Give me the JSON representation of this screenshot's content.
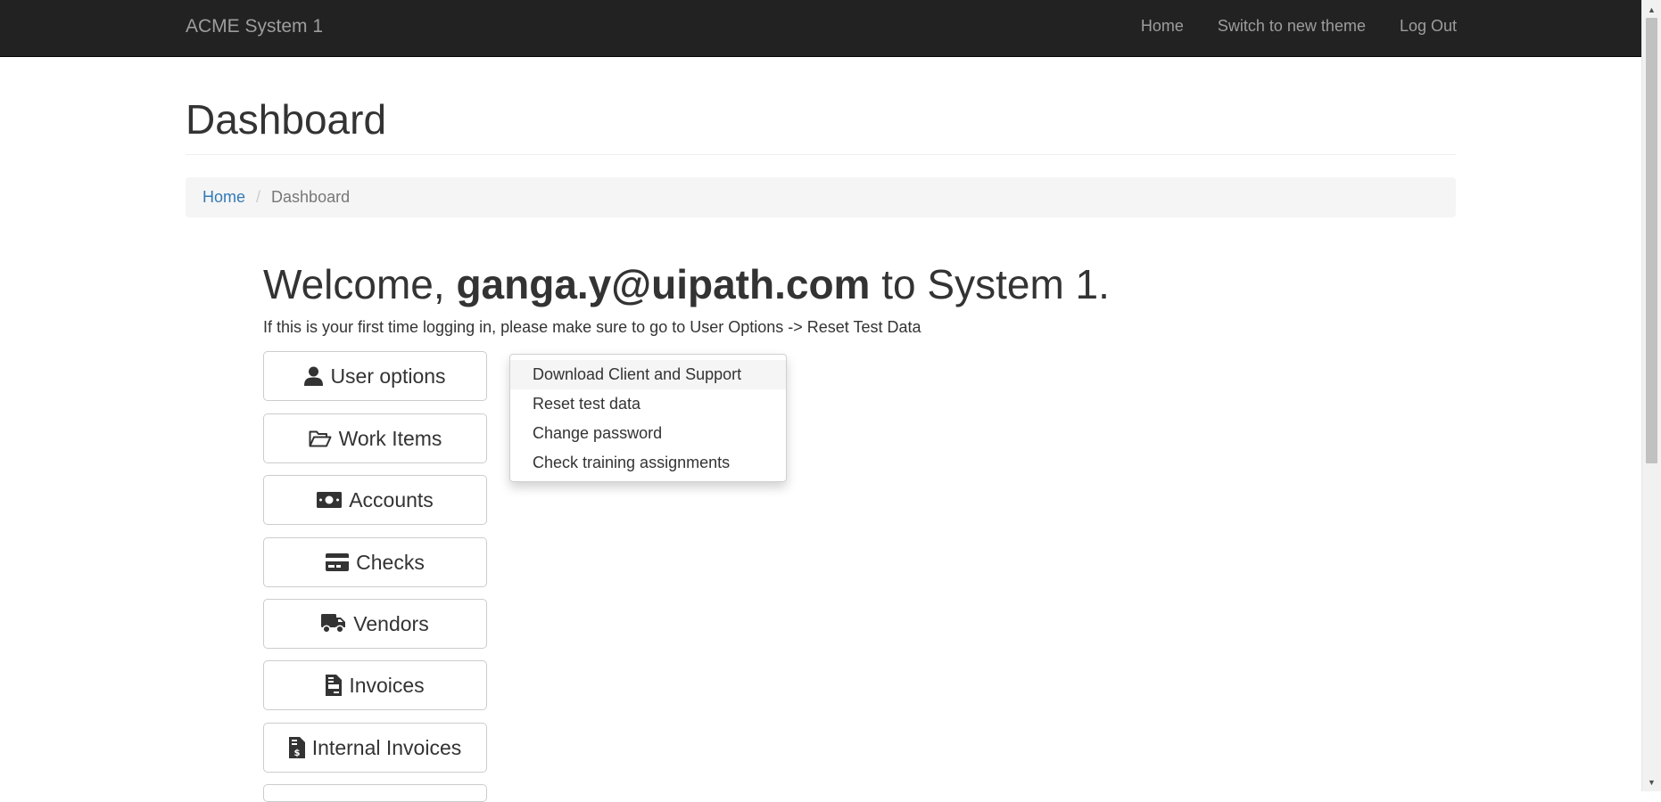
{
  "navbar": {
    "brand": "ACME System 1",
    "links": [
      "Home",
      "Switch to new theme",
      "Log Out"
    ]
  },
  "page": {
    "title": "Dashboard"
  },
  "breadcrumb": {
    "home": "Home",
    "separator": "/",
    "current": "Dashboard"
  },
  "welcome": {
    "prefix": "Welcome, ",
    "user": "ganga.y@uipath.com",
    "suffix": " to System 1.",
    "hint": "If this is your first time logging in, please make sure to go to User Options -> Reset Test Data"
  },
  "menu": [
    {
      "label": "User options",
      "icon": "user-icon"
    },
    {
      "label": "Work Items",
      "icon": "folder-open-icon"
    },
    {
      "label": "Accounts",
      "icon": "money-bill-icon"
    },
    {
      "label": "Checks",
      "icon": "credit-card-icon"
    },
    {
      "label": "Vendors",
      "icon": "truck-icon"
    },
    {
      "label": "Invoices",
      "icon": "file-invoice-icon"
    },
    {
      "label": "Internal Invoices",
      "icon": "file-invoice-dollar-icon"
    }
  ],
  "dropdown": {
    "items": [
      "Download Client and Support",
      "Reset test data",
      "Change password",
      "Check training assignments"
    ]
  },
  "colors": {
    "navbar_bg": "#222222",
    "navbar_text": "#9d9d9d",
    "link": "#337ab7",
    "breadcrumb_bg": "#f5f5f5",
    "text": "#333333"
  }
}
